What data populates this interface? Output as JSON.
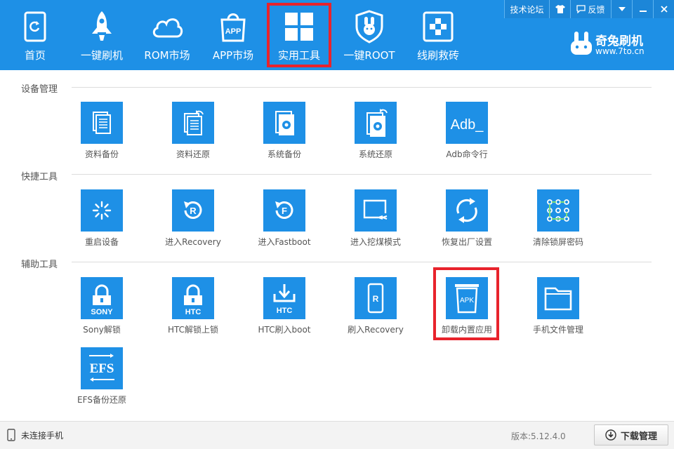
{
  "top_buttons": {
    "forum": "技术论坛",
    "feedback": "反馈"
  },
  "nav": [
    {
      "label": "首页",
      "icon": "phone-refresh-icon"
    },
    {
      "label": "一键刷机",
      "icon": "rocket-icon"
    },
    {
      "label": "ROM市场",
      "icon": "cloud-icon"
    },
    {
      "label": "APP市场",
      "icon": "app-bag-icon"
    },
    {
      "label": "实用工具",
      "icon": "grid-icon",
      "active": true
    },
    {
      "label": "一键ROOT",
      "icon": "rabbit-shield-icon"
    },
    {
      "label": "线刷救砖",
      "icon": "plus-square-icon"
    }
  ],
  "brand": {
    "name": "奇兔刷机",
    "url": "www.7to.cn"
  },
  "sections": [
    {
      "title": "设备管理",
      "tools": [
        {
          "label": "资料备份",
          "icon": "doc-backup-icon"
        },
        {
          "label": "资料还原",
          "icon": "doc-restore-icon"
        },
        {
          "label": "系统备份",
          "icon": "system-backup-icon"
        },
        {
          "label": "系统还原",
          "icon": "system-restore-icon"
        },
        {
          "label": "Adb命令行",
          "icon": "adb-icon",
          "icon_text": "Adb_"
        }
      ]
    },
    {
      "title": "快捷工具",
      "tools": [
        {
          "label": "重启设备",
          "icon": "restart-icon"
        },
        {
          "label": "进入Recovery",
          "icon": "recovery-icon",
          "icon_text": "R"
        },
        {
          "label": "进入Fastboot",
          "icon": "fastboot-icon",
          "icon_text": "F"
        },
        {
          "label": "进入挖煤模式",
          "icon": "screen-arrow-icon"
        },
        {
          "label": "恢复出厂设置",
          "icon": "factory-reset-icon"
        },
        {
          "label": "清除锁屏密码",
          "icon": "pattern-lock-icon"
        }
      ]
    },
    {
      "title": "辅助工具",
      "tools": [
        {
          "label": "Sony解锁",
          "icon": "sony-unlock-icon",
          "icon_text": "SONY"
        },
        {
          "label": "HTC解锁上锁",
          "icon": "htc-unlock-icon",
          "icon_text": "HTC"
        },
        {
          "label": "HTC刷入boot",
          "icon": "htc-boot-icon",
          "icon_text": "HTC"
        },
        {
          "label": "刷入Recovery",
          "icon": "flash-recovery-icon",
          "icon_text": "R"
        },
        {
          "label": "卸载内置应用",
          "icon": "apk-trash-icon",
          "icon_text": "APK",
          "highlighted": true
        },
        {
          "label": "手机文件管理",
          "icon": "folder-icon"
        },
        {
          "label": "EFS备份还原",
          "icon": "efs-icon",
          "icon_text": "EFS"
        }
      ]
    }
  ],
  "status": {
    "connection": "未连接手机",
    "version": "版本:5.12.4.0",
    "download_button": "下载管理"
  },
  "colors": {
    "header_bg": "#1e90e6",
    "tile_bg": "#1e90e6",
    "highlight": "#e8232c"
  }
}
